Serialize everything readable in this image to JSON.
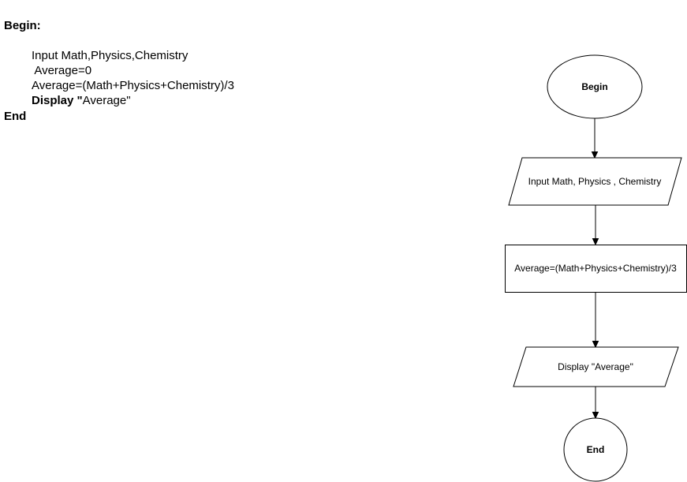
{
  "pseudocode": {
    "begin": "Begin:",
    "input": "Input Math,Physics,Chemistry",
    "init": " Average=0",
    "calc": "Average=(Math+Physics+Chemistry)/3",
    "display_keyword": "Display \"",
    "display_value": "Average\"",
    "end": "End"
  },
  "flowchart": {
    "start": "Begin",
    "input": "Input Math, Physics , Chemistry",
    "process": "Average=(Math+Physics+Chemistry)/3",
    "output": "Display \"Average\"",
    "stop": "End"
  }
}
